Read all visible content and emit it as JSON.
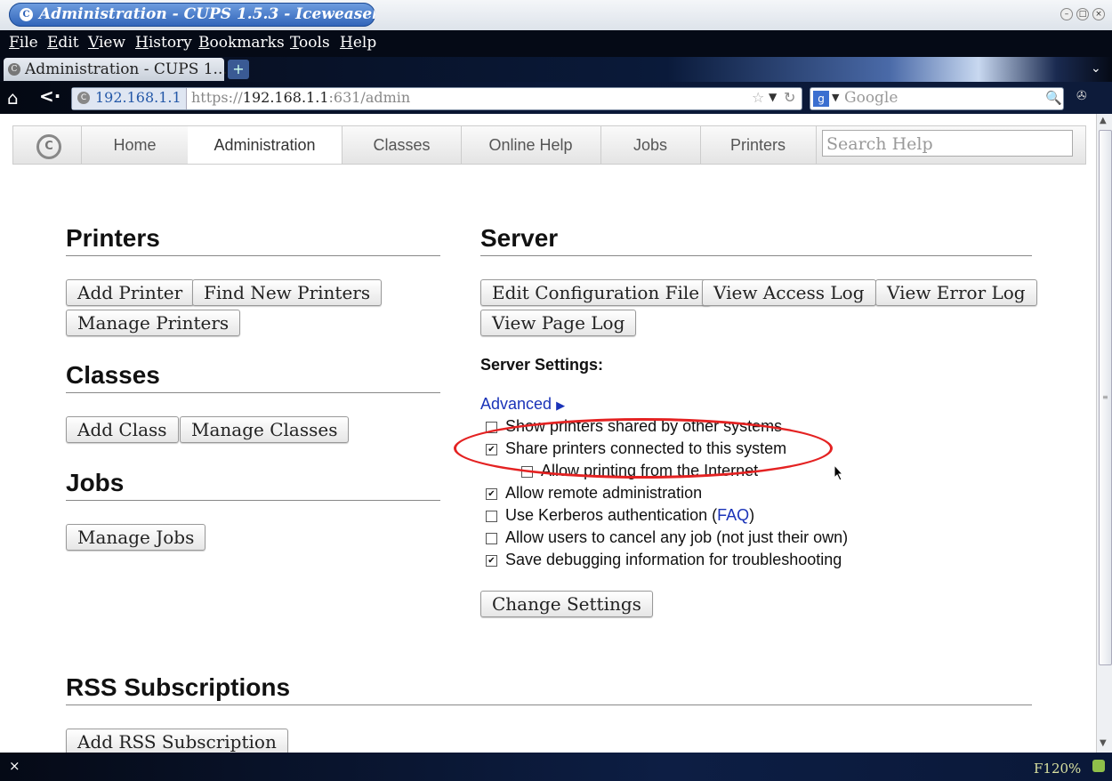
{
  "window": {
    "title": "Administration - CUPS 1.5.3 - Iceweasel"
  },
  "menu": [
    "File",
    "Edit",
    "View",
    "History",
    "Bookmarks",
    "Tools",
    "Help"
  ],
  "tab": {
    "title": "Administration - CUPS 1...."
  },
  "urlbar": {
    "identity": "192.168.1.1",
    "scheme": "https://",
    "host": "192.168.1.1",
    "rest": ":631/admin"
  },
  "search_engine": {
    "placeholder": "Google"
  },
  "cups_nav": {
    "tabs": [
      "Home",
      "Administration",
      "Classes",
      "Online Help",
      "Jobs",
      "Printers"
    ],
    "active": "Administration",
    "search_placeholder": "Search Help"
  },
  "printers": {
    "heading": "Printers",
    "buttons": [
      "Add Printer",
      "Find New Printers",
      "Manage Printers"
    ]
  },
  "classes": {
    "heading": "Classes",
    "buttons": [
      "Add Class",
      "Manage Classes"
    ]
  },
  "jobs": {
    "heading": "Jobs",
    "buttons": [
      "Manage Jobs"
    ]
  },
  "server": {
    "heading": "Server",
    "buttons": [
      "Edit Configuration File",
      "View Access Log",
      "View Error Log",
      "View Page Log"
    ],
    "settings_heading": "Server Settings:",
    "advanced_link": "Advanced",
    "advanced_arrow": "▶",
    "options": [
      {
        "label": "Show printers shared by other systems",
        "checked": false
      },
      {
        "label": "Share printers connected to this system",
        "checked": true
      },
      {
        "label": "Allow printing from the Internet",
        "checked": false
      },
      {
        "label": "Allow remote administration",
        "checked": true
      },
      {
        "label": "Use Kerberos authentication (",
        "link": "FAQ",
        "suffix": ")",
        "checked": false
      },
      {
        "label": "Allow users to cancel any job (not just their own)",
        "checked": false
      },
      {
        "label": "Save debugging information for troubleshooting",
        "checked": true
      }
    ],
    "change_button": "Change Settings"
  },
  "rss": {
    "heading": "RSS Subscriptions",
    "buttons": [
      "Add RSS Subscription"
    ]
  },
  "statusbar": {
    "zoom": "F120%",
    "close": "×"
  },
  "colors": {
    "highlight": "#e42222",
    "link": "#1a33b8",
    "chrome": "#050a16"
  }
}
